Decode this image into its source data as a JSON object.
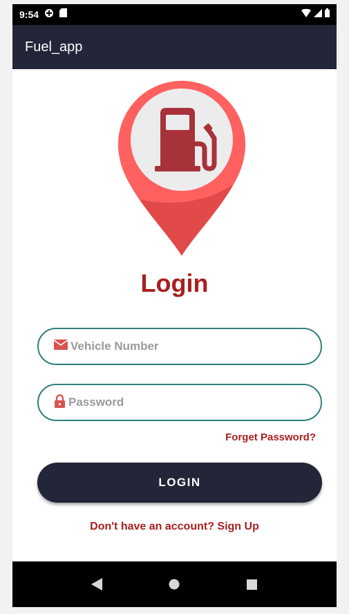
{
  "status_bar": {
    "time": "9:54",
    "icons": [
      "data-saver-icon",
      "sd-card-icon",
      "wifi-icon",
      "signal-icon",
      "battery-icon"
    ]
  },
  "app_bar": {
    "title": "Fuel_app"
  },
  "logo": {
    "icon": "fuel-pump-map-pin-icon"
  },
  "login": {
    "title": "Login",
    "vehicle_placeholder": "Vehicle Number",
    "vehicle_value": "",
    "vehicle_icon": "envelope-icon",
    "password_placeholder": "Password",
    "password_value": "",
    "password_icon": "lock-icon",
    "forgot_label": "Forget Password?",
    "button_label": "LOGIN",
    "signup_label": "Don't have an account? Sign Up"
  },
  "nav_bar": {
    "icons": [
      "back-icon",
      "home-icon",
      "recents-icon"
    ]
  },
  "colors": {
    "app_bar": "#222638",
    "accent_red": "#a91f1f",
    "pin_red": "#e24a4a",
    "pin_light": "#ff6161",
    "pin_circle": "#ececec",
    "field_border": "#2f7f7a",
    "button_bg": "#222638"
  }
}
